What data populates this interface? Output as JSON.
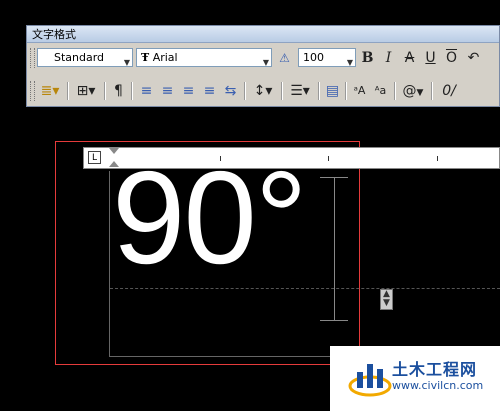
{
  "window": {
    "title": "文字格式"
  },
  "toolbar": {
    "style_value": "Standard",
    "font_icon": "truetype-T-icon",
    "font_value": "Arial",
    "height_value": "100",
    "bold_label": "B",
    "italic_label": "I",
    "strike_label": "A",
    "underline_label": "U",
    "overline_label": "O",
    "undo_glyph": "↶",
    "at_label": "@",
    "oblique_label": "0/"
  },
  "editor": {
    "ruler_corner_label": "L",
    "content": "90°"
  },
  "watermark": {
    "name": "土木工程网",
    "url": "www.civilcn.com"
  }
}
